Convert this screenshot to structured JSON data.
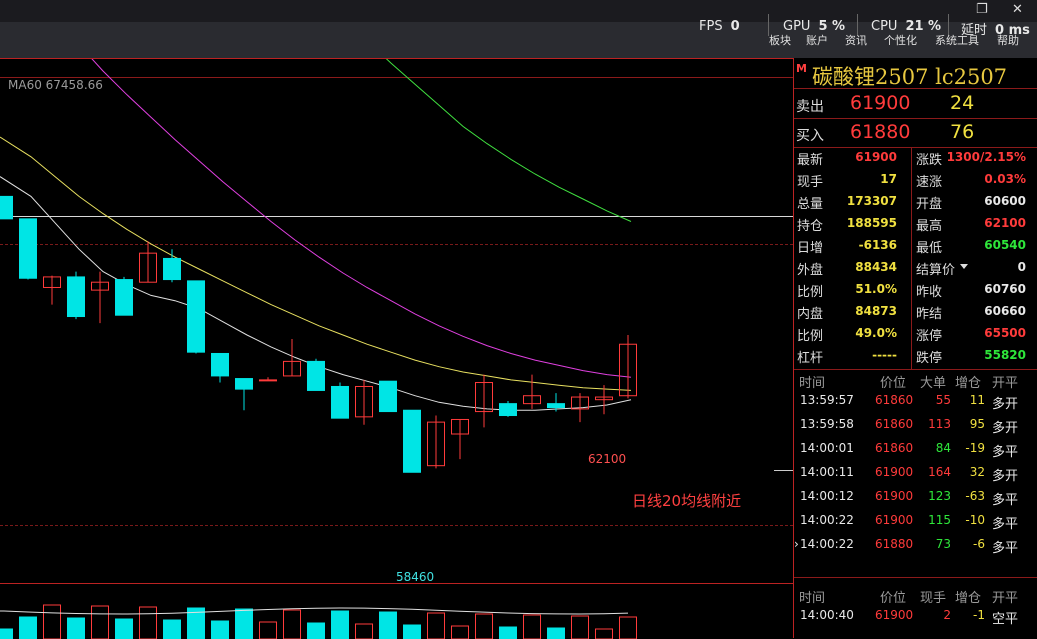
{
  "perf": {
    "fps_label": "FPS",
    "fps_value": "0",
    "gpu_label": "GPU",
    "gpu_value": "5 %",
    "cpu_label": "CPU",
    "cpu_value": "21 %",
    "latency_label": "延时",
    "latency_value": "0 ms"
  },
  "menu": [
    "板块",
    "账户",
    "资讯",
    "个性化",
    "系统工具",
    "帮助"
  ],
  "chart": {
    "ma_label": "MA60 67458.66",
    "high_label": "62100",
    "low_label": "58460",
    "annotation": "日线20均线附近",
    "colors": {
      "up": "#ff3b3b",
      "down": "#00e5e5",
      "ma5": "#e0e0e0",
      "ma10": "#e8e060",
      "ma20": "#e040e0",
      "ma40": "#40e040",
      "ma60": "#909090"
    },
    "candles": [
      {
        "o": 61050,
        "c": 60880,
        "h": 61050,
        "l": 60880
      },
      {
        "o": 60880,
        "c": 60430,
        "h": 60880,
        "l": 60420
      },
      {
        "o": 60360,
        "c": 60440,
        "h": 60450,
        "l": 60230
      },
      {
        "o": 60440,
        "c": 60140,
        "h": 60480,
        "l": 60120
      },
      {
        "o": 60340,
        "c": 60400,
        "h": 60480,
        "l": 60090
      },
      {
        "o": 60420,
        "c": 60150,
        "h": 60440,
        "l": 60150
      },
      {
        "o": 60400,
        "c": 60620,
        "h": 60710,
        "l": 60400
      },
      {
        "o": 60580,
        "c": 60420,
        "h": 60650,
        "l": 60400
      },
      {
        "o": 60410,
        "c": 59870,
        "h": 60410,
        "l": 59860
      },
      {
        "o": 59860,
        "c": 59690,
        "h": 59860,
        "l": 59640
      },
      {
        "o": 59670,
        "c": 59590,
        "h": 59670,
        "l": 59430
      },
      {
        "o": 59660,
        "c": 59660,
        "h": 59680,
        "l": 59660
      },
      {
        "o": 59690,
        "c": 59800,
        "h": 59970,
        "l": 59690
      },
      {
        "o": 59800,
        "c": 59580,
        "h": 59820,
        "l": 59580
      },
      {
        "o": 59610,
        "c": 59370,
        "h": 59640,
        "l": 59370
      },
      {
        "o": 59380,
        "c": 59610,
        "h": 59660,
        "l": 59320
      },
      {
        "o": 59650,
        "c": 59420,
        "h": 59650,
        "l": 59420
      },
      {
        "o": 59430,
        "c": 58960,
        "h": 59430,
        "l": 58960
      },
      {
        "o": 59010,
        "c": 59340,
        "h": 59390,
        "l": 58990
      },
      {
        "o": 59250,
        "c": 59360,
        "h": 59360,
        "l": 59060
      },
      {
        "o": 59420,
        "c": 59640,
        "h": 59700,
        "l": 59300
      },
      {
        "o": 59480,
        "c": 59390,
        "h": 59500,
        "l": 59380
      },
      {
        "o": 59480,
        "c": 59540,
        "h": 59700,
        "l": 59440
      },
      {
        "o": 59480,
        "c": 59450,
        "h": 59560,
        "l": 59420
      },
      {
        "o": 59440,
        "c": 59530,
        "h": 59560,
        "l": 59340
      },
      {
        "o": 59510,
        "c": 59530,
        "h": 59620,
        "l": 59400
      },
      {
        "o": 59540,
        "c": 59930,
        "h": 60000,
        "l": 59520
      }
    ],
    "ma5": [
      61200,
      61050,
      60850,
      60650,
      60480,
      60380,
      60300,
      60260,
      60200,
      60100,
      60000,
      59910,
      59830,
      59760,
      59700,
      59650,
      59600,
      59540,
      59490,
      59460,
      59440,
      59430,
      59430,
      59440,
      59450,
      59470,
      59510
    ],
    "ma10": [
      61500,
      61350,
      61200,
      61050,
      60920,
      60800,
      60690,
      60590,
      60500,
      60410,
      60320,
      60230,
      60150,
      60070,
      60000,
      59930,
      59870,
      59810,
      59760,
      59720,
      59690,
      59660,
      59640,
      59620,
      59600,
      59590,
      59580
    ],
    "ma20": [
      62900,
      62650,
      62420,
      62200,
      62000,
      61820,
      61650,
      61480,
      61320,
      61160,
      61010,
      60860,
      60720,
      60590,
      60470,
      60360,
      60260,
      60160,
      60070,
      59990,
      59920,
      59860,
      59810,
      59770,
      59730,
      59700,
      59680
    ],
    "ma40": [
      65350,
      65050,
      64800,
      64560,
      64330,
      64110,
      63900,
      63690,
      63490,
      63300,
      63110,
      62930,
      62750,
      62570,
      62400,
      62230,
      62060,
      61900,
      61740,
      61580,
      61450,
      61330,
      61220,
      61120,
      61030,
      60940,
      60860
    ],
    "ma60": [
      66300,
      66130,
      65960,
      65800,
      65640,
      65480,
      65320,
      65160,
      65010,
      64860,
      64710,
      64560,
      64420,
      64280,
      64140,
      64000,
      63860,
      63720,
      63580,
      63440,
      63300,
      63160,
      63020,
      62880,
      62740,
      62600,
      62460
    ]
  },
  "instrument": {
    "title": "碳酸锂2507 lc2507",
    "m_badge": "M"
  },
  "bidask": [
    {
      "label": "卖出",
      "price": "61900",
      "volume": "24"
    },
    {
      "label": "买入",
      "price": "61880",
      "volume": "76"
    }
  ],
  "quote": [
    {
      "l1": "最新",
      "v1": "61900",
      "c1": "red",
      "l2": "涨跌",
      "v2": "1300/2.15%",
      "c2": "red"
    },
    {
      "l1": "现手",
      "v1": "17",
      "c1": "yel",
      "l2": "速涨",
      "v2": "0.03%",
      "c2": "red"
    },
    {
      "l1": "总量",
      "v1": "173307",
      "c1": "yel",
      "l2": "开盘",
      "v2": "60600",
      "c2": "wht"
    },
    {
      "l1": "持仓",
      "v1": "188595",
      "c1": "yel",
      "l2": "最高",
      "v2": "62100",
      "c2": "red"
    },
    {
      "l1": "日增",
      "v1": "-6136",
      "c1": "yel",
      "l2": "最低",
      "v2": "60540",
      "c2": "grn"
    },
    {
      "l1": "外盘",
      "v1": "88434",
      "c1": "yel",
      "l2": "结算价",
      "v2": "0",
      "c2": "wht"
    },
    {
      "l1": "比例",
      "v1": "51.0%",
      "c1": "yel",
      "l2": "昨收",
      "v2": "60760",
      "c2": "wht"
    },
    {
      "l1": "内盘",
      "v1": "84873",
      "c1": "yel",
      "l2": "昨结",
      "v2": "60660",
      "c2": "wht"
    },
    {
      "l1": "比例",
      "v1": "49.0%",
      "c1": "yel",
      "l2": "涨停",
      "v2": "65500",
      "c2": "red"
    },
    {
      "l1": "杠杆",
      "v1": "-----",
      "c1": "yel",
      "l2": "跌停",
      "v2": "55820",
      "c2": "grn"
    }
  ],
  "trades_header": [
    "时间",
    "价位",
    "大单",
    "增仓",
    "开平"
  ],
  "trades": [
    {
      "time": "13:59:57",
      "price": "61860",
      "size": "55",
      "chg": "11",
      "type": "多开",
      "sc": "red",
      "cc": "yel",
      "tc": "wht"
    },
    {
      "time": "13:59:58",
      "price": "61860",
      "size": "113",
      "chg": "95",
      "type": "多开",
      "sc": "red",
      "cc": "yel",
      "tc": "wht"
    },
    {
      "time": "14:00:01",
      "price": "61860",
      "size": "84",
      "chg": "-19",
      "type": "多平",
      "sc": "grn",
      "cc": "yel",
      "tc": "wht"
    },
    {
      "time": "14:00:11",
      "price": "61900",
      "size": "164",
      "chg": "32",
      "type": "多开",
      "sc": "red",
      "cc": "yel",
      "tc": "wht"
    },
    {
      "time": "14:00:12",
      "price": "61900",
      "size": "123",
      "chg": "-63",
      "type": "多平",
      "sc": "grn",
      "cc": "yel",
      "tc": "wht"
    },
    {
      "time": "14:00:22",
      "price": "61900",
      "size": "115",
      "chg": "-10",
      "type": "多平",
      "sc": "grn",
      "cc": "yel",
      "tc": "wht"
    },
    {
      "time": "14:00:22",
      "price": "61880",
      "size": "73",
      "chg": "-6",
      "type": "多平",
      "sc": "grn",
      "cc": "yel",
      "tc": "wht"
    }
  ],
  "ticks_header": [
    "时间",
    "价位",
    "现手",
    "增仓",
    "开平"
  ],
  "ticks": [
    {
      "time": "14:00:40",
      "price": "61900",
      "size": "2",
      "chg": "-1",
      "type": "空平"
    }
  ]
}
